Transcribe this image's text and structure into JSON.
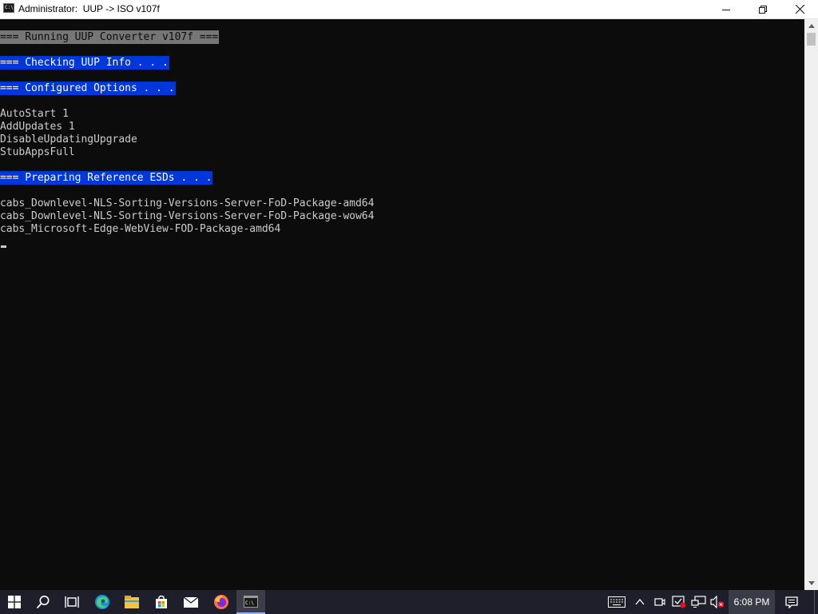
{
  "window": {
    "title": "Administrator:  UUP -> ISO v107f",
    "icon_text": "C:\\",
    "controls": [
      "minimize-icon",
      "maximize-icon",
      "close-icon"
    ]
  },
  "console": {
    "header_running": "=== Running UUP Converter v107f ===",
    "header_checking": "=== Checking UUP Info . . .",
    "header_configured": "=== Configured Options . . .",
    "options": [
      "AutoStart 1",
      "AddUpdates 1",
      "DisableUpdatingUpgrade",
      "StubAppsFull"
    ],
    "header_preparing": "=== Preparing Reference ESDs . . .",
    "packages": [
      "cabs_Downlevel-NLS-Sorting-Versions-Server-FoD-Package-amd64",
      "cabs_Downlevel-NLS-Sorting-Versions-Server-FoD-Package-wow64",
      "cabs_Microsoft-Edge-WebView-FOD-Package-amd64"
    ],
    "colors": {
      "background": "#0c0c0c",
      "text": "#cccccc",
      "highlight_gray": "#767676",
      "highlight_blue": "#0037da"
    }
  },
  "taskbar": {
    "apps": [
      "windows-start-icon",
      "search-icon",
      "task-view-icon",
      "edge-icon",
      "file-explorer-icon",
      "store-icon",
      "mail-icon",
      "firefox-icon",
      "command-prompt-icon"
    ],
    "tray_icons": [
      "keyboard-icon",
      "chevron-up-icon",
      "meet-now-icon",
      "defender-icon",
      "network-icon",
      "volume-muted-icon"
    ],
    "clock": "6:08 PM",
    "colors": {
      "background": "#1f1f2b"
    }
  }
}
